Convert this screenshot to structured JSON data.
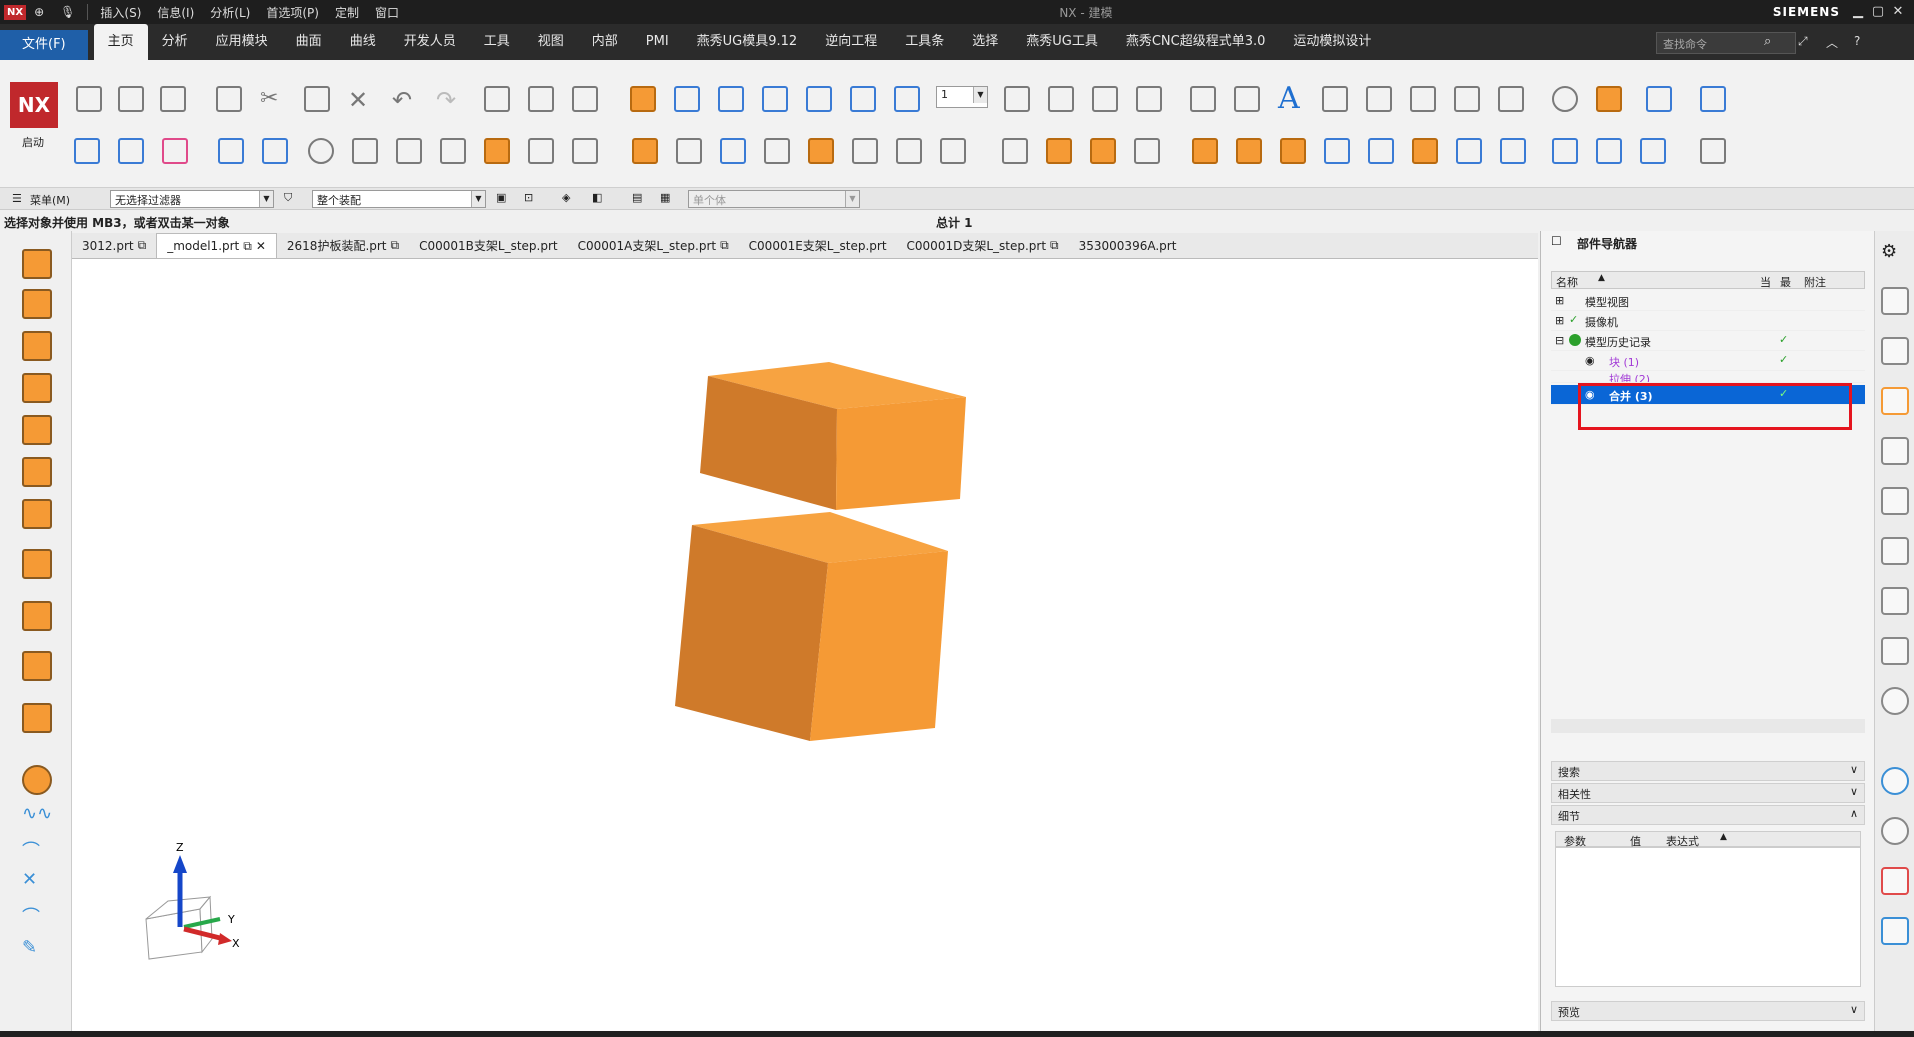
{
  "titlebar": {
    "menus": [
      "插入(S)",
      "信息(I)",
      "分析(L)",
      "首选项(P)",
      "定制",
      "窗口"
    ],
    "title": "NX - 建模",
    "brand": "SIEMENS"
  },
  "ribbon": {
    "file_label": "文件(F)",
    "tabs": [
      "主页",
      "分析",
      "应用模块",
      "曲面",
      "曲线",
      "开发人员",
      "工具",
      "视图",
      "内部",
      "PMI",
      "燕秀UG模具9.12",
      "逆向工程",
      "工具条",
      "选择",
      "燕秀UG工具",
      "燕秀CNC超级程式单3.0",
      "运动模拟设计"
    ],
    "active_tab": "主页",
    "search_placeholder": "查找命令",
    "start_label": "启动",
    "nx_logo": "NX",
    "layer_value": "1"
  },
  "filterbar": {
    "menu_label": "菜单(M)",
    "filter_value": "无选择过滤器",
    "assembly_value": "整个装配",
    "body_value": "单个体"
  },
  "status": {
    "prompt": "选择对象并使用 MB3，或者双击某一对象",
    "total": "总计 1"
  },
  "doc_tabs": [
    "3012.prt",
    "_model1.prt",
    "2618护板装配.prt",
    "C00001B支架L_step.prt",
    "C00001A支架L_step.prt",
    "C00001E支架L_step.prt",
    "C00001D支架L_step.prt",
    "353000396A.prt"
  ],
  "active_doc": "_model1.prt",
  "triad": {
    "z": "Z",
    "y": "Y",
    "x": "X"
  },
  "navigator": {
    "title": "部件导航器",
    "columns": [
      "名称",
      "当",
      "最",
      "附注"
    ],
    "rows": [
      {
        "label": "模型视图",
        "check": ""
      },
      {
        "label": "摄像机",
        "check": ""
      },
      {
        "label": "模型历史记录",
        "check": "✓"
      },
      {
        "label": "块 (1)",
        "check": "✓"
      },
      {
        "label": "拉伸 (2)",
        "check": "✓"
      },
      {
        "label": "合并 (3)",
        "check": "✓"
      }
    ],
    "sections": [
      "搜索",
      "相关性",
      "细节"
    ],
    "detail_columns": [
      "参数",
      "值",
      "表达式"
    ],
    "preview_label": "预览"
  },
  "colors": {
    "accent": "#1f5fa8",
    "selection": "#0a66d6",
    "highlight": "#e5141e",
    "solid": "#f59a35"
  }
}
